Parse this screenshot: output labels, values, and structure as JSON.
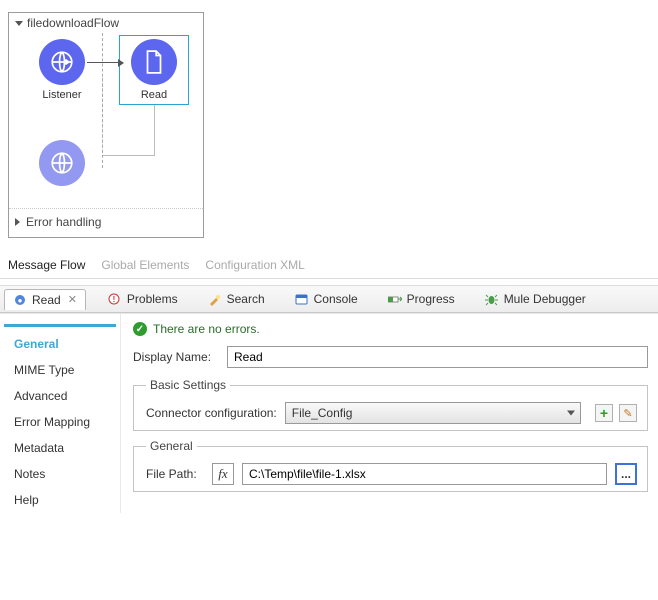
{
  "flow": {
    "title": "filedownloadFlow",
    "listener_label": "Listener",
    "read_label": "Read",
    "error_handling": "Error handling"
  },
  "view_tabs": {
    "message_flow": "Message Flow",
    "global_elements": "Global Elements",
    "config_xml": "Configuration XML"
  },
  "editor_tabs": {
    "read": "Read",
    "problems": "Problems",
    "search": "Search",
    "console": "Console",
    "progress": "Progress",
    "debugger": "Mule Debugger"
  },
  "side": {
    "general": "General",
    "mime": "MIME Type",
    "advanced": "Advanced",
    "error_mapping": "Error Mapping",
    "metadata": "Metadata",
    "notes": "Notes",
    "help": "Help"
  },
  "main": {
    "status": "There are no errors.",
    "display_name_label": "Display Name:",
    "display_name_value": "Read",
    "basic_legend": "Basic Settings",
    "connector_label": "Connector configuration:",
    "connector_value": "File_Config",
    "general_legend": "General",
    "file_path_label": "File Path:",
    "fx_label": "fx",
    "file_path_value": "C:\\Temp\\file\\file-1.xlsx",
    "dots": "..."
  }
}
